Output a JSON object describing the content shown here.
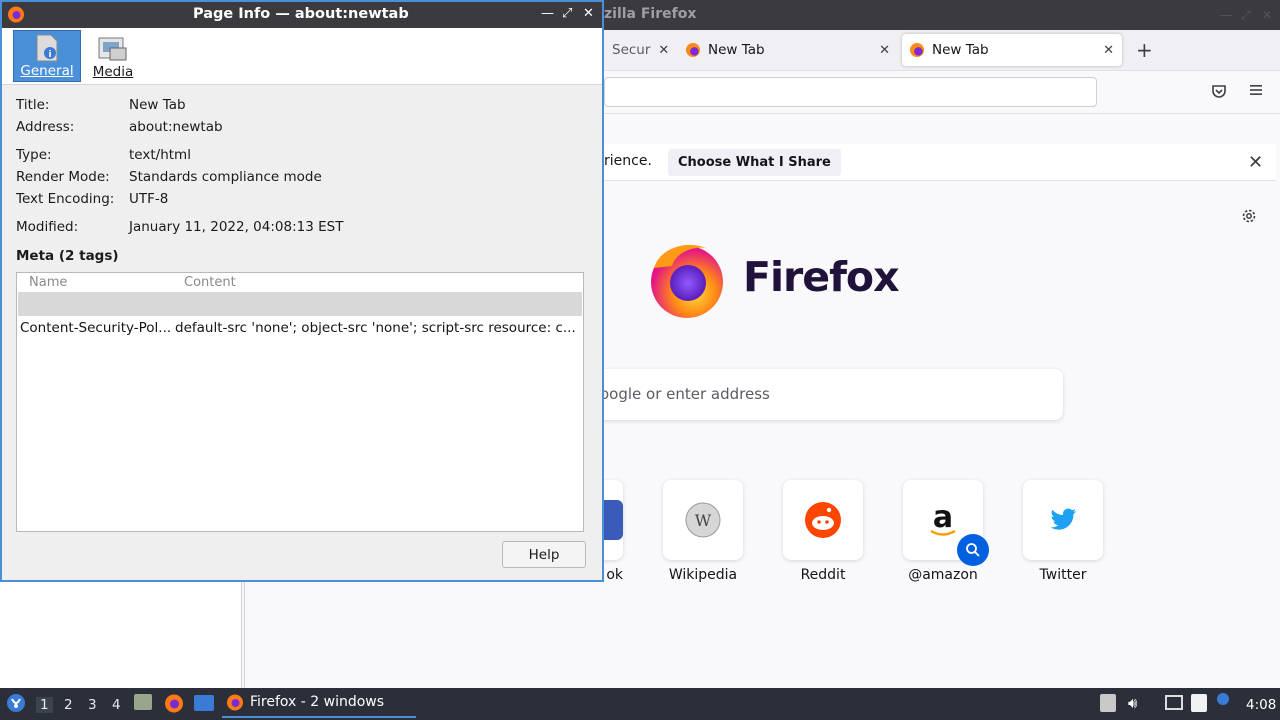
{
  "firefox": {
    "window_title": "zilla Firefox",
    "tabs": [
      {
        "label": "Secur"
      },
      {
        "label": "New Tab"
      },
      {
        "label": "New Tab"
      }
    ],
    "notification": {
      "text": "rience.",
      "button": "Choose What I Share"
    },
    "wordmark": "Firefox",
    "search_placeholder": "oogle or enter address",
    "top_sites": [
      {
        "label": "ok",
        "icon": "facebook-icon"
      },
      {
        "label": "Wikipedia",
        "icon": "wikipedia-icon"
      },
      {
        "label": "Reddit",
        "icon": "reddit-icon"
      },
      {
        "label": "@amazon",
        "icon": "amazon-icon"
      },
      {
        "label": "Twitter",
        "icon": "twitter-icon"
      }
    ]
  },
  "dialog": {
    "title": "Page Info — about:newtab",
    "tools": [
      {
        "label": "General",
        "selected": true
      },
      {
        "label": "Media",
        "selected": false
      }
    ],
    "fields": [
      {
        "label": "Title:",
        "value": "New Tab"
      },
      {
        "label": "Address:",
        "value": "about:newtab"
      },
      {
        "label": "Type:",
        "value": "text/html"
      },
      {
        "label": "Render Mode:",
        "value": "Standards compliance mode"
      },
      {
        "label": "Text Encoding:",
        "value": "UTF-8"
      },
      {
        "label": "Modified:",
        "value": "January 11, 2022, 04:08:13 EST"
      }
    ],
    "meta_heading": "Meta (2 tags)",
    "meta_columns": [
      "Name",
      "Content"
    ],
    "meta_rows": [
      {
        "name": "",
        "content": ""
      },
      {
        "name": "Content-Security-Pol...",
        "content": "default-src 'none'; object-src 'none'; script-src resource: c..."
      }
    ],
    "help_button": "Help"
  },
  "taskbar": {
    "workspaces": [
      "1",
      "2",
      "3",
      "4"
    ],
    "task_label": "Firefox - 2 windows",
    "clock": "4:08"
  },
  "colors": {
    "accent": "#4a90d9",
    "titlebar": "#3b3b3f",
    "taskbar": "#2b2f3a"
  }
}
